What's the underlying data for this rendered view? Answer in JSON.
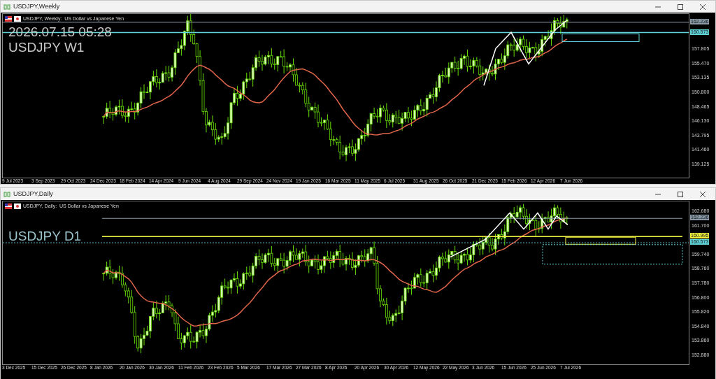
{
  "windows": [
    {
      "title": "USDJPY,Weekly",
      "header": "USDJPY, Weekly:  US Dollar vs Japanese Yen",
      "overlays": [
        "2026.07.15 05:28",
        "USDJPY W1"
      ],
      "price_ticks": [
        "157.805",
        "155.470",
        "153.135",
        "150.800",
        "148.465",
        "146.130",
        "143.795",
        "141.460",
        "139.125"
      ],
      "price_tags": [
        {
          "label": "162.236",
          "color": "#8a9aa8"
        },
        {
          "label": "160.573",
          "color": "#5fd3d8"
        }
      ],
      "date_ticks": [
        "9 Jul 2023",
        "3 Sep 2023",
        "29 Oct 2023",
        "24 Dec 2023",
        "18 Feb 2024",
        "14 Apr 2024",
        "9 Jun 2024",
        "4 Aug 2024",
        "29 Sep 2024",
        "24 Nov 2024",
        "19 Jan 2025",
        "16 Mar 2025",
        "11 May 2025",
        "6 Jul 2025",
        "31 Aug 2025",
        "26 Oct 2025",
        "21 Dec 2025",
        "15 Feb 2026",
        "12 Apr 2026",
        "7 Jun 2026"
      ]
    },
    {
      "title": "USDJPY,Daily",
      "header": "USDJPY, Daily:  US Dollar vs Japanese Yen",
      "overlays": [
        "USDJPY D1"
      ],
      "price_ticks": [
        "162.680",
        "161.700",
        "159.740",
        "158.760",
        "157.780",
        "156.800",
        "155.820",
        "154.840",
        "153.860",
        "152.880"
      ],
      "price_tags": [
        {
          "label": "162.236",
          "color": "#8a9aa8"
        },
        {
          "label": "160.995",
          "color": "#f0f040"
        },
        {
          "label": "160.573",
          "color": "#5fd3d8"
        }
      ],
      "date_ticks": [
        "3 Dec 2025",
        "15 Dec 2025",
        "26 Dec 2025",
        "8 Jan 2026",
        "20 Jan 2026",
        "30 Jan 2026",
        "11 Feb 2026",
        "23 Feb 2026",
        "5 Mar 2026",
        "17 Mar 2026",
        "27 Mar 2026",
        "8 Apr 2026",
        "20 Apr 2026",
        "30 Apr 2026",
        "12 May 2026",
        "22 May 2026",
        "3 Jun 2026",
        "15 Jun 2026",
        "25 Jun 2026",
        "7 Jul 2026"
      ]
    }
  ]
}
